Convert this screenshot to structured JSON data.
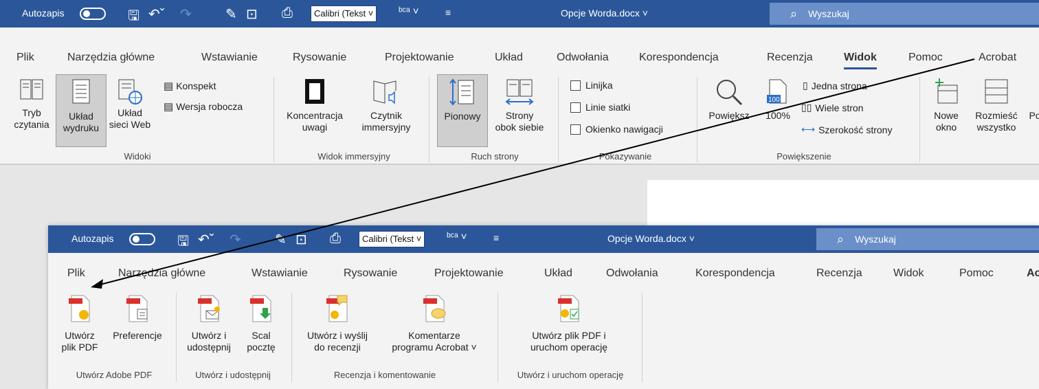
{
  "back": {
    "titlebar": {
      "autosave": "Autozapis",
      "font": "Calibri (Tekst",
      "doc_title": "Opcje Worda.docx",
      "search": "Wyszukaj"
    },
    "tabs": [
      "Plik",
      "Narzędzia główne",
      "Wstawianie",
      "Rysowanie",
      "Projektowanie",
      "Układ",
      "Odwołania",
      "Korespondencja",
      "Recenzja",
      "Widok",
      "Pomoc",
      "Acrobat"
    ],
    "active_tab": "Widok",
    "groups": {
      "widoki": {
        "label": "Widoki",
        "tryb_czytania": [
          "Tryb",
          "czytania"
        ],
        "uklad_wydruku": [
          "Układ",
          "wydruku"
        ],
        "uklad_sieci": [
          "Układ",
          "sieci Web"
        ],
        "konspekt": "Konspekt",
        "wersja_robocza": "Wersja robocza"
      },
      "immersyjny": {
        "label": "Widok immersyjny",
        "koncentracja": [
          "Koncentracja",
          "uwagi"
        ],
        "czytnik": [
          "Czytnik",
          "immersyjny"
        ]
      },
      "ruch": {
        "label": "Ruch strony",
        "pionowy": "Pionowy",
        "strony_obok": [
          "Strony",
          "obok siebie"
        ]
      },
      "pokazywanie": {
        "label": "Pokazywanie",
        "linijka": "Linijka",
        "linie_siatki": "Linie siatki",
        "okienko": "Okienko nawigacji"
      },
      "powiekszenie": {
        "label": "Powiększenie",
        "powieksz": "Powiększ",
        "procent": "100%",
        "jedna": "Jedna strona",
        "wiele": "Wiele stron",
        "szerokosc": "Szerokość strony"
      },
      "okno": {
        "nowe": [
          "Nowe",
          "okno"
        ],
        "rozmiesc": [
          "Rozmieść",
          "wszystko"
        ],
        "partial": "Po"
      }
    }
  },
  "front": {
    "titlebar": {
      "autosave": "Autozapis",
      "font": "Calibri (Tekst",
      "doc_title": "Opcje Worda.docx",
      "search": "Wyszukaj"
    },
    "tabs": [
      "Plik",
      "Narzędzia główne",
      "Wstawianie",
      "Rysowanie",
      "Projektowanie",
      "Układ",
      "Odwołania",
      "Korespondencja",
      "Recenzja",
      "Widok",
      "Pomoc",
      "Ac"
    ],
    "groups": {
      "adobe_pdf": {
        "label": "Utwórz Adobe PDF",
        "utworz_pdf": [
          "Utwórz",
          "plik PDF"
        ],
        "preferencje": "Preferencje"
      },
      "udostepnij": {
        "label": "Utwórz i udostępnij",
        "utworz_udostepnij": [
          "Utwórz i",
          "udostępnij"
        ],
        "scal": [
          "Scal",
          "pocztę"
        ]
      },
      "recenzja": {
        "label": "Recenzja i komentowanie",
        "wyslij": [
          "Utwórz i wyślij",
          "do recenzji"
        ],
        "komentarze": [
          "Komentarze",
          "programu Acrobat ˅"
        ]
      },
      "operacje": {
        "label": "Utwórz i uruchom operację",
        "uruchom": [
          "Utwórz plik PDF i",
          "uruchom operację"
        ]
      }
    }
  },
  "colors": {
    "titlebar": "#2b579a",
    "ribbon": "#f3f3f3",
    "pdf_red": "#d9312b",
    "arrow": "#000000"
  }
}
